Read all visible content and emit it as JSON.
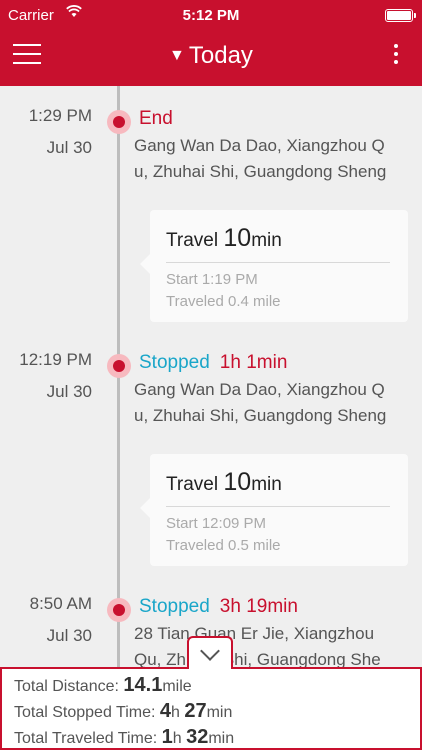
{
  "status_bar": {
    "carrier": "Carrier",
    "time": "5:12 PM"
  },
  "header": {
    "title": "Today"
  },
  "stops": [
    {
      "time": "1:29 PM",
      "date": "Jul 30",
      "event": "End",
      "event_color": "#c8102e",
      "duration": "",
      "address_lines": [
        "Gang Wan Da Dao, Xiangzhou Q",
        "u, Zhuhai Shi, Guangdong Sheng"
      ]
    },
    {
      "time": "12:19 PM",
      "date": "Jul 30",
      "event": "Stopped",
      "event_color": "#1aa6c9",
      "duration": "1h 1min",
      "address_lines": [
        "Gang Wan Da Dao, Xiangzhou Q",
        "u, Zhuhai Shi, Guangdong Sheng"
      ]
    },
    {
      "time": "8:50 AM",
      "date": "Jul 30",
      "event": "Stopped",
      "event_color": "#1aa6c9",
      "duration": "3h 19min",
      "address_lines": [
        "28 Tian Guan Er Jie, Xiangzhou",
        "Qu, Zhuhai Shi, Guangdong She"
      ]
    }
  ],
  "travels": [
    {
      "label": "Travel",
      "value": "10",
      "unit": "min",
      "start": "Start 1:19 PM",
      "traveled": "Traveled 0.4 mile"
    },
    {
      "label": "Travel",
      "value": "10",
      "unit": "min",
      "start": "Start 12:09 PM",
      "traveled": "Traveled 0.5 mile"
    }
  ],
  "summary": {
    "distance_label": "Total Distance: ",
    "distance_value": "14.1",
    "distance_unit": "mile",
    "stopped_label": "Total Stopped Time: ",
    "stopped_h": "4",
    "stopped_h_unit": "h ",
    "stopped_m": "27",
    "stopped_m_unit": "min",
    "traveled_label": "Total Traveled Time: ",
    "traveled_h": "1",
    "traveled_h_unit": "h ",
    "traveled_m": "32",
    "traveled_m_unit": "min"
  },
  "colors": {
    "brand": "#c8102e",
    "stopped": "#1aa6c9"
  }
}
